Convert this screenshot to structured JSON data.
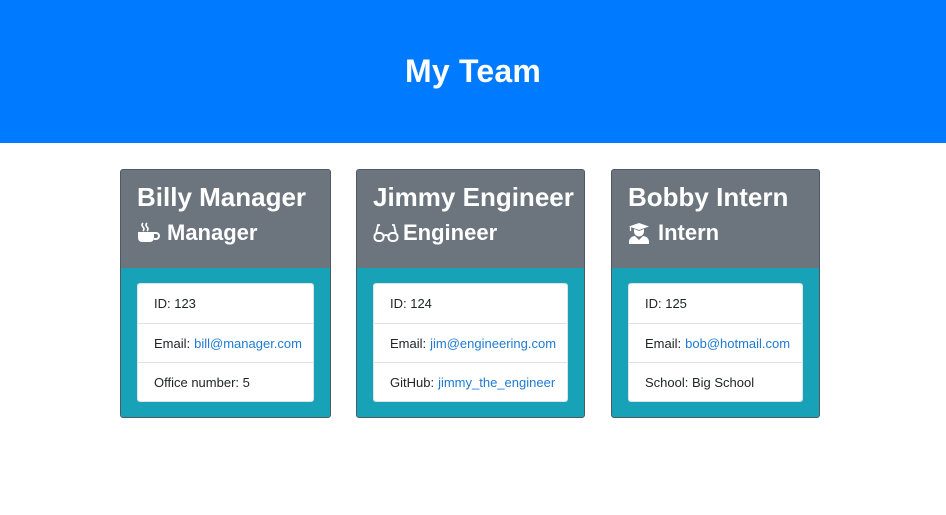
{
  "header": {
    "title": "My Team"
  },
  "cards": [
    {
      "name": "Billy Manager",
      "role": "Manager",
      "icon": "coffee-icon",
      "id_label": "ID: 123",
      "email_prefix": "Email:",
      "email": "bill@manager.com",
      "extra_label": "Office number: 5"
    },
    {
      "name": "Jimmy Engineer",
      "role": "Engineer",
      "icon": "glasses-icon",
      "id_label": "ID: 124",
      "email_prefix": "Email:",
      "email": "jim@engineering.com",
      "extra_prefix": "GitHub:",
      "github": "jimmy_the_engineer"
    },
    {
      "name": "Bobby Intern",
      "role": "Intern",
      "icon": "user-graduate-icon",
      "id_label": "ID: 125",
      "email_prefix": "Email:",
      "email": "bob@hotmail.com",
      "extra_label": "School: Big School"
    }
  ],
  "colors": {
    "header_bg": "#007bff",
    "card_header_bg": "#6c757d",
    "card_body_bg": "#17a2b8",
    "link": "#1f7ad4"
  }
}
